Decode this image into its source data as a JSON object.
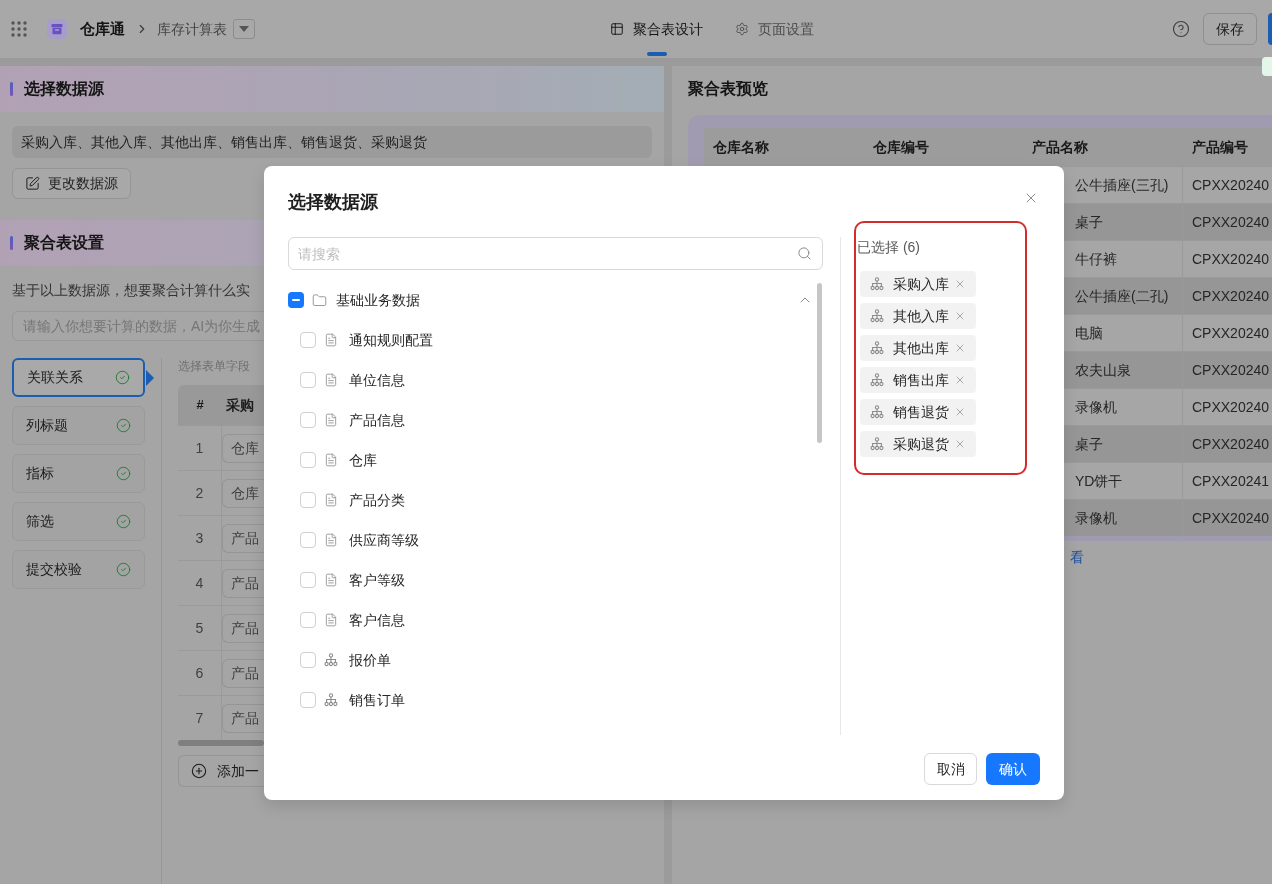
{
  "top_bar": {
    "app_name": "仓库通",
    "breadcrumb": "库存计算表",
    "tabs": [
      {
        "label": "聚合表设计",
        "kind": "table",
        "selected": true
      },
      {
        "label": "页面设置",
        "kind": "settings",
        "selected": false
      }
    ],
    "save_button": "保存"
  },
  "data_source": {
    "title": "选择数据源",
    "sources": "采购入库、其他入库、其他出库、销售出库、销售退货、采购退货",
    "change_button": "更改数据源"
  },
  "aggregate_settings": {
    "title": "聚合表设置",
    "prompt": "基于以上数据源，想要聚合计算什么实",
    "input_placeholder": "请输入你想要计算的数据，AI为你生成",
    "steps": [
      {
        "label": "关联关系",
        "selected": true,
        "done": true
      },
      {
        "label": "列标题",
        "selected": false,
        "done": true
      },
      {
        "label": "指标",
        "selected": false,
        "done": true
      },
      {
        "label": "筛选",
        "selected": false,
        "done": true
      },
      {
        "label": "提交校验",
        "selected": false,
        "done": true
      }
    ],
    "hint": "选择表单字段",
    "table": {
      "columns": [
        "#",
        "采购"
      ],
      "rows": [
        [
          "1",
          "仓库"
        ],
        [
          "2",
          "仓库"
        ],
        [
          "3",
          "产品"
        ],
        [
          "4",
          "产品"
        ],
        [
          "5",
          "产品"
        ],
        [
          "6",
          "产品"
        ],
        [
          "7",
          "产品"
        ]
      ]
    },
    "add_button": "添加一"
  },
  "preview": {
    "title": "聚合表预览",
    "table": {
      "columns": [
        "仓库名称",
        "仓库编号",
        "产品名称",
        "产品编号"
      ],
      "rows": [
        {
          "product_name": "公牛插座(三孔)",
          "product_code": "CPXX20240"
        },
        {
          "product_name": "桌子",
          "product_code": "CPXX20240"
        },
        {
          "product_name": "牛仔裤",
          "product_code": "CPXX20240"
        },
        {
          "product_name": "公牛插座(二孔)",
          "product_code": "CPXX20240"
        },
        {
          "product_name": "电脑",
          "product_code": "CPXX20240"
        },
        {
          "product_name": "农夫山泉",
          "product_code": "CPXX20240"
        },
        {
          "product_name": "录像机",
          "product_code": "CPXX20240"
        },
        {
          "product_name": "桌子",
          "product_code": "CPXX20240"
        },
        {
          "product_name": "YD饼干",
          "product_code": "CPXX20241"
        },
        {
          "product_name": "录像机",
          "product_code": "CPXX20240"
        }
      ]
    },
    "link": "看"
  },
  "dialog": {
    "title": "选择数据源",
    "search_placeholder": "请搜索",
    "tree": [
      {
        "label": "基础业务数据",
        "kind": "folder",
        "indeterminate": true,
        "expanded": true,
        "children": [
          {
            "label": "通知规则配置",
            "kind": "form",
            "checked": false
          },
          {
            "label": "单位信息",
            "kind": "form",
            "checked": false
          },
          {
            "label": "产品信息",
            "kind": "form",
            "checked": false
          },
          {
            "label": "仓库",
            "kind": "form",
            "checked": false
          },
          {
            "label": "产品分类",
            "kind": "form",
            "checked": false
          },
          {
            "label": "供应商等级",
            "kind": "form",
            "checked": false
          },
          {
            "label": "客户等级",
            "kind": "form",
            "checked": false
          },
          {
            "label": "客户信息",
            "kind": "form",
            "checked": false
          },
          {
            "label": "报价单",
            "kind": "flow",
            "checked": false
          },
          {
            "label": "销售订单",
            "kind": "flow",
            "checked": false
          }
        ]
      }
    ],
    "selected": {
      "title": "已选择 (6)",
      "highlighted": true,
      "items": [
        "采购入库",
        "其他入库",
        "其他出库",
        "销售出库",
        "销售退货",
        "采购退货"
      ]
    },
    "cancel_button": "取消",
    "confirm_button": "确认"
  }
}
